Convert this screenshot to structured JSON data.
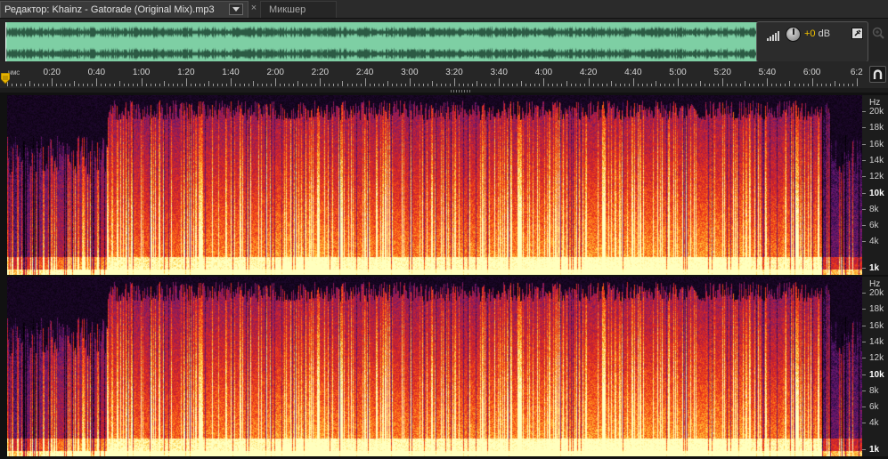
{
  "tabs": {
    "editor_label": "Редактор: Khainz - Gatorade (Original Mix).mp3",
    "mixer_label": "Микшер",
    "close_symbol": "×"
  },
  "overview": {
    "waveform_color": "#7ecfa4",
    "volume": {
      "value": "+0",
      "unit": "dB"
    },
    "icons": [
      "volume-bars-icon",
      "knob-icon",
      "pin-icon",
      "zoom-magnifier-icon"
    ]
  },
  "timeline": {
    "unit_label": "чмс",
    "ticks": [
      "0:20",
      "0:40",
      "1:00",
      "1:20",
      "1:40",
      "2:00",
      "2:20",
      "2:40",
      "3:00",
      "3:20",
      "3:40",
      "4:00",
      "4:20",
      "4:40",
      "5:00",
      "5:20",
      "5:40",
      "6:00",
      "6:2"
    ],
    "total_seconds": 380
  },
  "frequency_scale": {
    "unit": "Hz",
    "labels": [
      "20k",
      "18k",
      "16k",
      "14k",
      "12k",
      "10k",
      "8k",
      "6k",
      "4k",
      "1k"
    ],
    "bold_labels": [
      "10k",
      "1k"
    ]
  },
  "spectral": {
    "channels": [
      "left",
      "right"
    ],
    "palette": [
      "#000000",
      "#2a0a3d",
      "#6b1a7a",
      "#b0204a",
      "#e8321c",
      "#ff7a18",
      "#ffd54a",
      "#ffffc0"
    ]
  }
}
